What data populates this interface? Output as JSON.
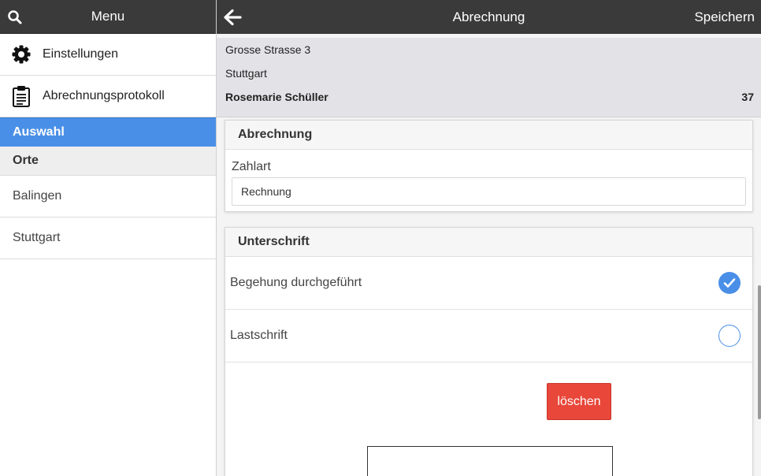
{
  "sidebar": {
    "header_title": "Menu",
    "items": [
      {
        "label": "Einstellungen",
        "icon": "gear-icon"
      },
      {
        "label": "Abrechnungsprotokoll",
        "icon": "clipboard-icon"
      }
    ],
    "active_divider": "Auswahl",
    "group_divider": "Orte",
    "places": [
      "Balingen",
      "Stuttgart"
    ]
  },
  "header": {
    "title": "Abrechnung",
    "save_label": "Speichern"
  },
  "info": {
    "street": "Grosse Strasse 3",
    "city": "Stuttgart",
    "name": "Rosemarie Schüller",
    "number": "37"
  },
  "billing": {
    "title": "Abrechnung",
    "payment_label": "Zahlart",
    "payment_value": "Rechnung"
  },
  "signature": {
    "title": "Unterschrift",
    "options": [
      {
        "label": "Begehung durchgeführt",
        "checked": true
      },
      {
        "label": "Lastschrift",
        "checked": false
      }
    ],
    "delete_label": "löschen"
  },
  "colors": {
    "accent": "#4a8fe7",
    "header_bg": "#3a3a3a",
    "delete": "#e8473a"
  }
}
